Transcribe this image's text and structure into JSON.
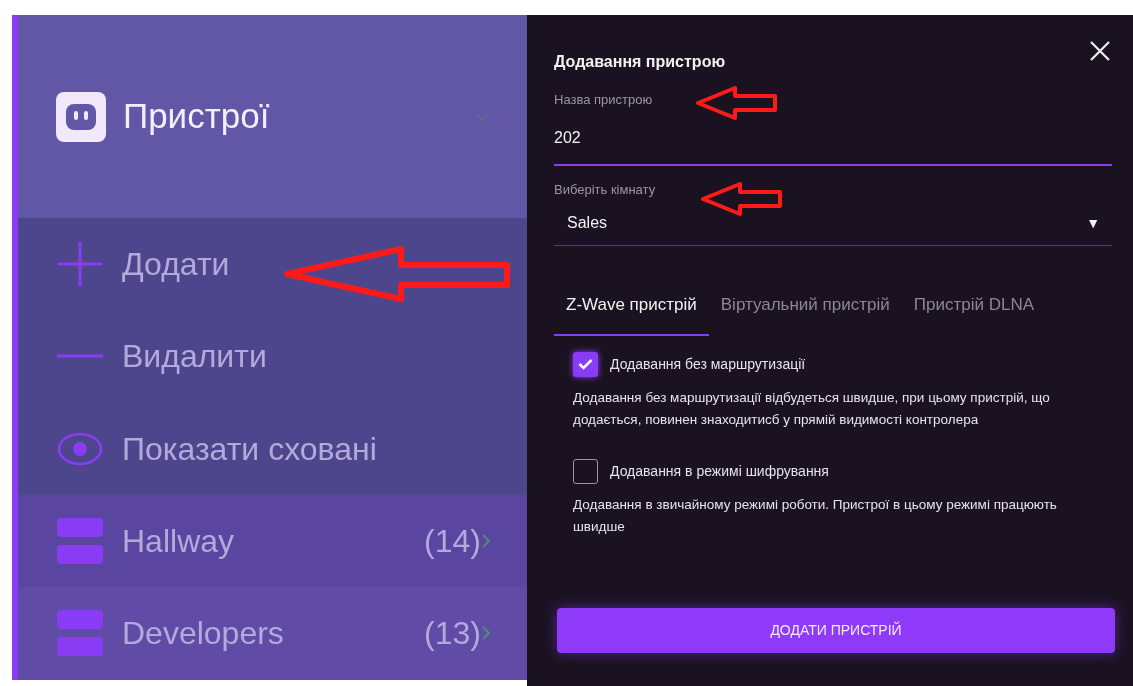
{
  "sidebar": {
    "title": "Пристрої",
    "actions": [
      {
        "kind": "add",
        "label": "Додати"
      },
      {
        "kind": "remove",
        "label": "Видалити"
      },
      {
        "kind": "show_hidden",
        "label": "Показати сховані"
      }
    ],
    "rooms": [
      {
        "name": "Hallway",
        "count": "(14)"
      },
      {
        "name": "Developers",
        "count": "(13)"
      }
    ]
  },
  "dialog": {
    "title": "Додавання пристрою",
    "name_field": {
      "label": "Назва пристрою",
      "value": "202"
    },
    "room_select": {
      "label": "Виберіть кімнату",
      "value": "Sales",
      "arrow": "▼"
    },
    "tabs": [
      {
        "label": "Z-Wave пристрій",
        "selected": true
      },
      {
        "label": "Віртуальний пристрій",
        "selected": false
      },
      {
        "label": "Пристрій DLNA",
        "selected": false
      }
    ],
    "options": [
      {
        "label": "Додавання без маршрутизації",
        "checked": true,
        "description": "Додавання без маршрутизації відбудеться швидше, при цьому пристрій, що додається, повинен знаходитисб у прямій видимості контролера"
      },
      {
        "label": "Додавання в режимі шифрування",
        "checked": false,
        "description": "Додавання в звичайному режимі роботи. Пристрої в цьому режимі працюють швидше"
      }
    ],
    "submit": "ДОДАТИ ПРИСТРІЙ"
  }
}
